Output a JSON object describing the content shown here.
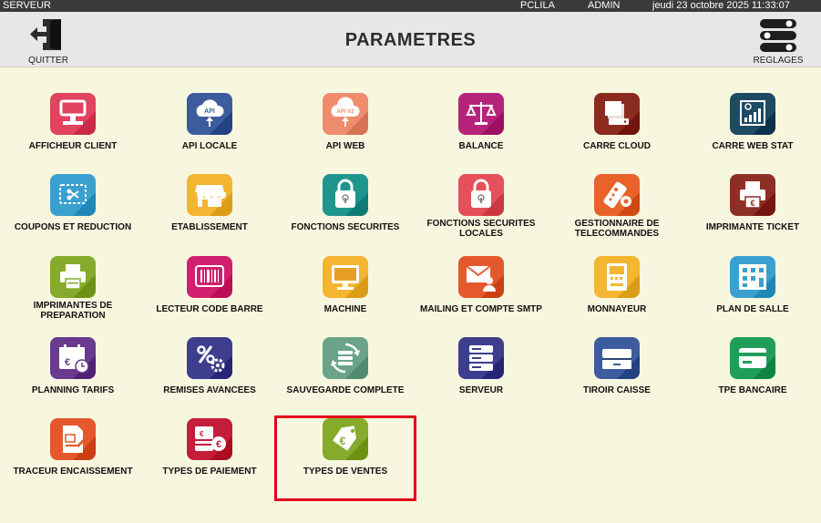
{
  "status": {
    "server": "SERVEUR",
    "machine": "PCLILA",
    "user": "ADMIN",
    "datetime": "jeudi 23 octobre 2025  11:33:07"
  },
  "header": {
    "title": "PARAMETRES",
    "quit_label": "QUITTER",
    "settings_label": "REGLAGES"
  },
  "tiles": [
    {
      "label": "AFFICHEUR CLIENT",
      "icon": "display-icon",
      "color": "#e2435f"
    },
    {
      "label": "API LOCALE",
      "icon": "api-cloud-icon",
      "color": "#3d5c9e"
    },
    {
      "label": "API WEB",
      "icon": "api-v2-cloud-icon",
      "color": "#f08c6e"
    },
    {
      "label": "BALANCE",
      "icon": "scale-icon",
      "color": "#b5247a"
    },
    {
      "label": "CARRE CLOUD",
      "icon": "cloud-server-icon",
      "color": "#8b2b1f"
    },
    {
      "label": "CARRE WEB STAT",
      "icon": "web-stat-icon",
      "color": "#1f4a63"
    },
    {
      "label": "COUPONS ET REDUCTION",
      "icon": "coupon-icon",
      "color": "#3aa0cf"
    },
    {
      "label": "ETABLISSEMENT",
      "icon": "shop-icon",
      "color": "#f4b531"
    },
    {
      "label": "FONCTIONS SECURITES",
      "icon": "lock-icon",
      "color": "#20958d"
    },
    {
      "label": "FONCTIONS SECURITES LOCALES",
      "icon": "lock-icon",
      "color": "#e5505a"
    },
    {
      "label": "GESTIONNAIRE DE TELECOMMANDES",
      "icon": "remote-icon",
      "color": "#e8622a"
    },
    {
      "label": "IMPRIMANTE TICKET",
      "icon": "printer-euro-icon",
      "color": "#8e2f25"
    },
    {
      "label": "IMPRIMANTES DE PREPARATION",
      "icon": "printer-icon",
      "color": "#86aa2c"
    },
    {
      "label": "LECTEUR CODE BARRE",
      "icon": "barcode-icon",
      "color": "#d21f6f"
    },
    {
      "label": "MACHINE",
      "icon": "monitor-icon",
      "color": "#f4b531"
    },
    {
      "label": "MAILING ET COMPTE SMTP",
      "icon": "mail-user-icon",
      "color": "#e5582d"
    },
    {
      "label": "MONNAYEUR",
      "icon": "cash-machine-icon",
      "color": "#f4b531"
    },
    {
      "label": "PLAN DE SALLE",
      "icon": "floor-plan-icon",
      "color": "#3aa0cf"
    },
    {
      "label": "PLANNING TARIFS",
      "icon": "calendar-euro-icon",
      "color": "#6a3a8f"
    },
    {
      "label": "REMISES AVANCEES",
      "icon": "percent-gear-icon",
      "color": "#3e3e8e"
    },
    {
      "label": "SAUVEGARDE COMPLETE",
      "icon": "backup-icon",
      "color": "#6aa38a"
    },
    {
      "label": "SERVEUR",
      "icon": "server-icon",
      "color": "#3e3e8e"
    },
    {
      "label": "TIROIR CAISSE",
      "icon": "cash-drawer-icon",
      "color": "#3d5c9e"
    },
    {
      "label": "TPE BANCAIRE",
      "icon": "card-icon",
      "color": "#1f9e5a"
    },
    {
      "label": "TRACEUR ENCAISSEMENT",
      "icon": "receipt-icon",
      "color": "#e5582d"
    },
    {
      "label": "TYPES DE PAIEMENT",
      "icon": "payment-euro-icon",
      "color": "#c41e3a"
    },
    {
      "label": "TYPES DE VENTES",
      "icon": "price-tag-euro-icon",
      "color": "#86aa2c"
    }
  ],
  "selected_index": 26
}
